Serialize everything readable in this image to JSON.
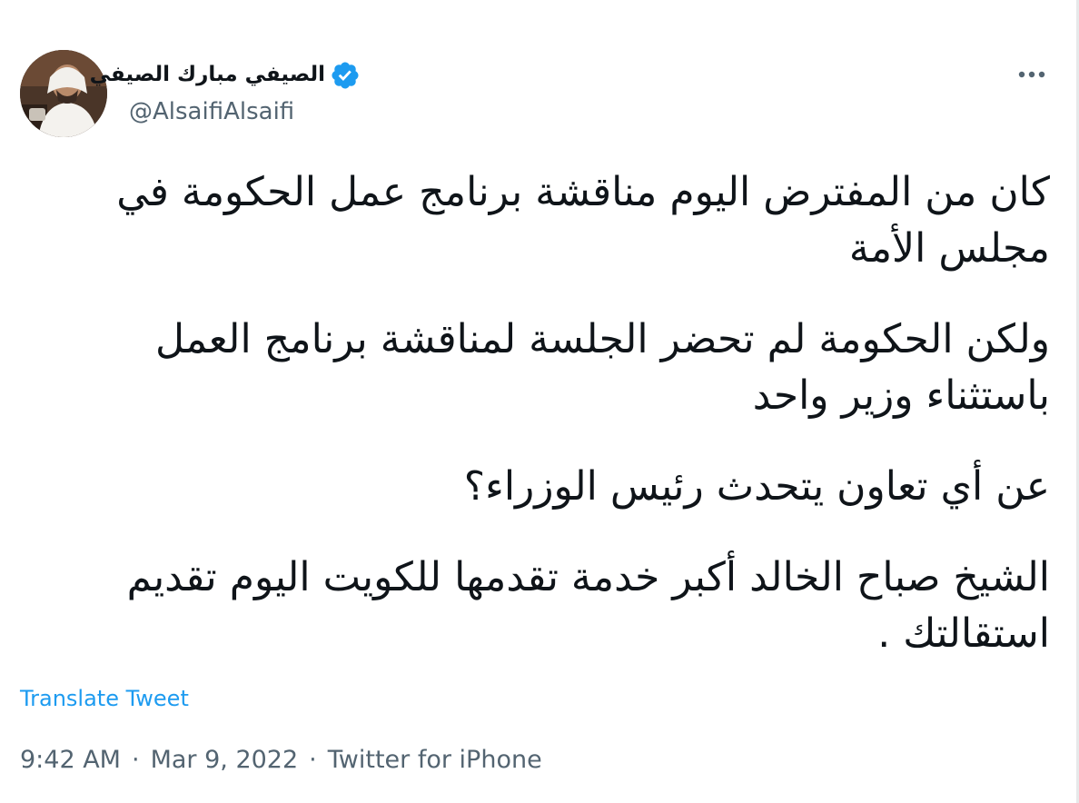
{
  "tweet": {
    "author": {
      "display_name": "الصيفي مبارك الصيفي",
      "handle": "@AlsaifiAlsaifi",
      "verified": true,
      "avatar_icon": "profile-photo"
    },
    "paragraphs": [
      "كان من المفترض اليوم مناقشة برنامج عمل الحكومة في مجلس الأمة",
      "ولكن الحكومة لم تحضر الجلسة لمناقشة برنامج العمل باستثناء وزير واحد",
      "عن أي تعاون يتحدث رئيس الوزراء؟",
      "الشيخ صباح الخالد أكبر خدمة تقدمها للكويت اليوم تقديم استقالتك ."
    ],
    "translate_label": "Translate Tweet",
    "time": "9:42 AM",
    "date": "Mar 9, 2022",
    "source": "Twitter for iPhone",
    "separator": "·"
  },
  "colors": {
    "text_primary": "#0f1419",
    "text_secondary": "#536471",
    "accent": "#1d9bf0"
  },
  "icons": {
    "verified": "verified-badge-icon",
    "more": "more-options-icon"
  }
}
